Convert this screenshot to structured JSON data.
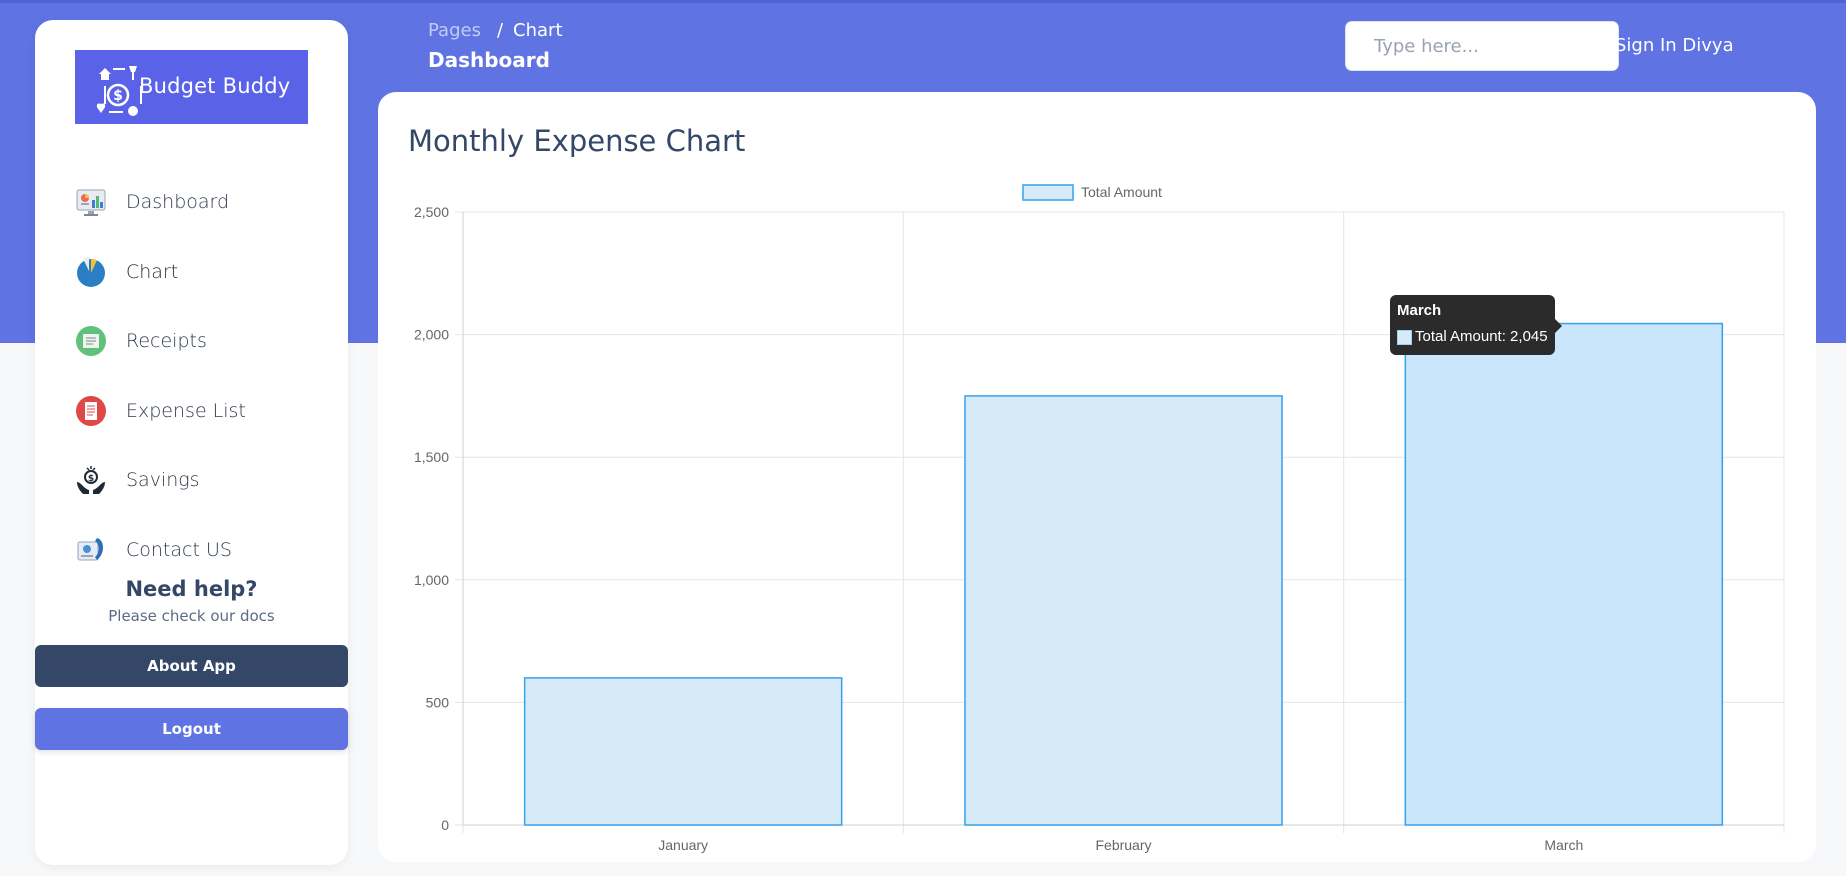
{
  "brand": {
    "name": "Budget Buddy"
  },
  "sidebar": {
    "items": [
      {
        "label": "Dashboard",
        "icon": "dashboard-monitor-icon"
      },
      {
        "label": "Chart",
        "icon": "pie-chart-icon",
        "active": true
      },
      {
        "label": "Receipts",
        "icon": "receipt-icon"
      },
      {
        "label": "Expense List",
        "icon": "expense-list-icon"
      },
      {
        "label": "Savings",
        "icon": "savings-hands-icon"
      },
      {
        "label": "Contact US",
        "icon": "contact-phone-icon"
      }
    ],
    "help": {
      "title": "Need help?",
      "subtitle": "Please check our docs"
    },
    "about_label": "About App",
    "logout_label": "Logout"
  },
  "header": {
    "breadcrumb_root": "Pages",
    "breadcrumb_separator": "/",
    "breadcrumb_current": "Chart",
    "page_title": "Dashboard",
    "search_placeholder": "Type here...",
    "signin_label": "Sign In Divya"
  },
  "card": {
    "title": "Monthly Expense Chart"
  },
  "colors": {
    "primary": "#5f73e3",
    "navy": "#344767",
    "bar_fill": "#d6eaf7",
    "bar_fill_hover": "#c9e6fb",
    "bar_border": "#36a2eb"
  },
  "chart_data": {
    "type": "bar",
    "categories": [
      "January",
      "February",
      "March"
    ],
    "series": [
      {
        "name": "Total Amount",
        "values": [
          600,
          1750,
          2045
        ]
      }
    ],
    "ylim": [
      0,
      2500
    ],
    "yticks": [
      0,
      500,
      1000,
      1500,
      2000,
      2500
    ],
    "ytick_labels": [
      "0",
      "500",
      "1,000",
      "1,500",
      "2,000",
      "2,500"
    ],
    "grid": true,
    "legend": "top-center",
    "xlabel": "",
    "ylabel": "",
    "tooltip": {
      "title": "March",
      "label": "Total Amount: 2,045"
    }
  }
}
